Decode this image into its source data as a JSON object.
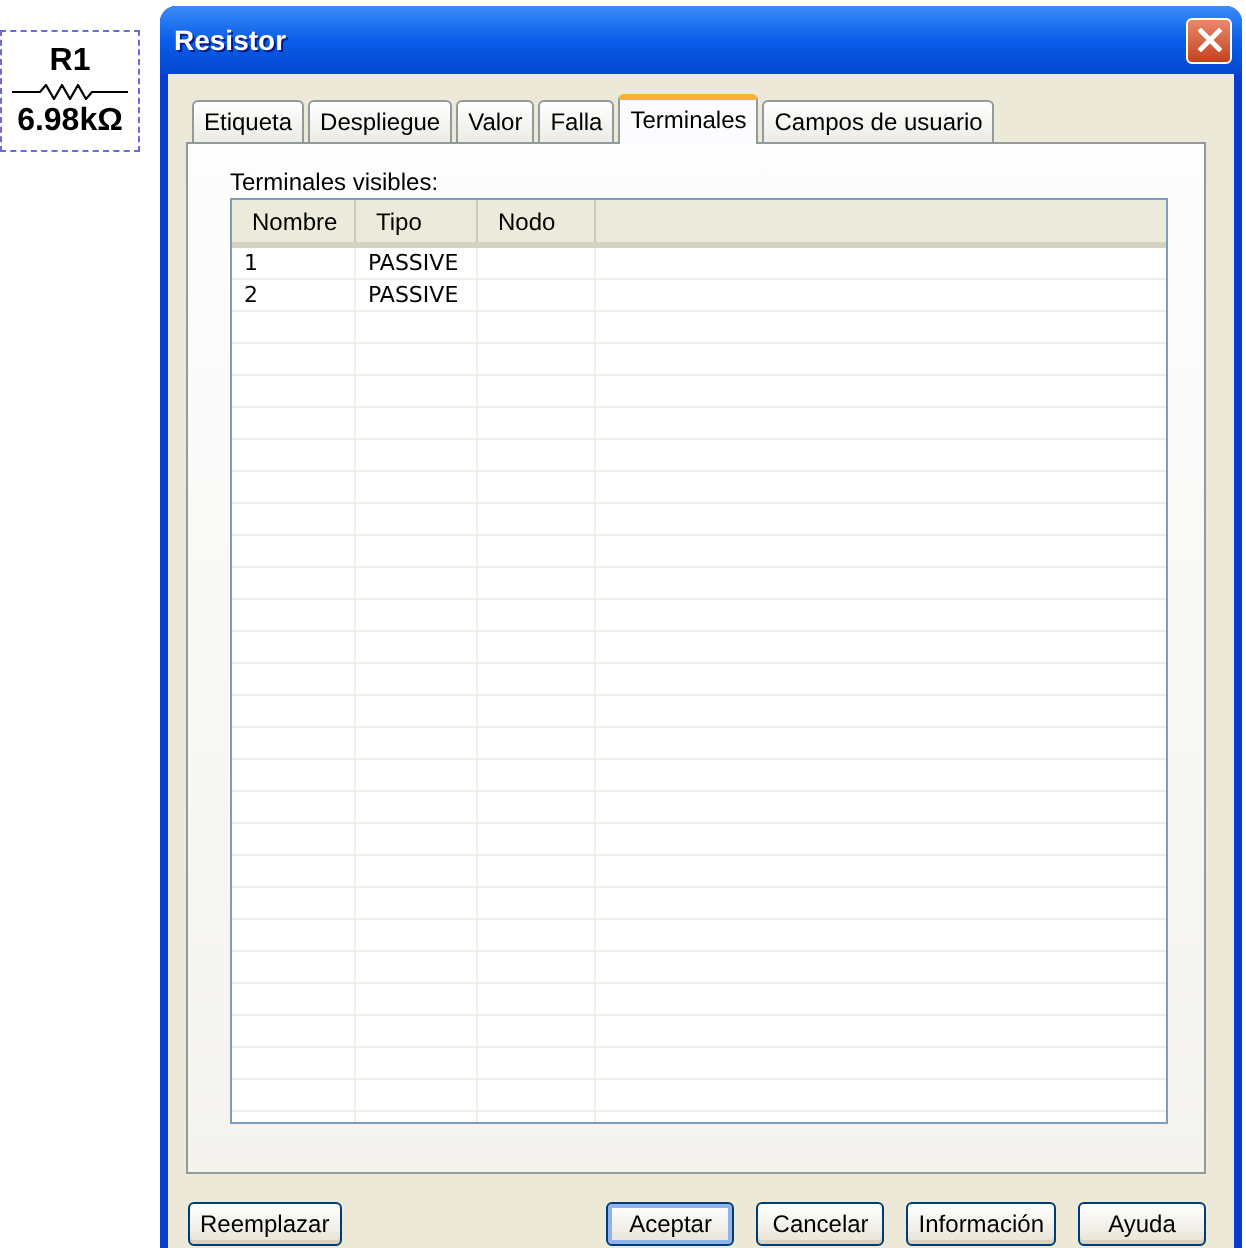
{
  "component": {
    "label": "R1",
    "value": "6.98kΩ"
  },
  "window": {
    "title": "Resistor"
  },
  "tabs": [
    {
      "label": "Etiqueta",
      "selected": false
    },
    {
      "label": "Despliegue",
      "selected": false
    },
    {
      "label": "Valor",
      "selected": false
    },
    {
      "label": "Falla",
      "selected": false
    },
    {
      "label": "Terminales",
      "selected": true
    },
    {
      "label": "Campos de usuario",
      "selected": false
    }
  ],
  "terminals": {
    "label": "Terminales visibles:",
    "columns": [
      "Nombre",
      "Tipo",
      "Nodo"
    ],
    "rows": [
      [
        "1",
        "PASSIVE"
      ],
      [
        "2",
        "PASSIVE"
      ]
    ]
  },
  "footer": {
    "left": [
      {
        "label": "Reemplazar",
        "default": false
      }
    ],
    "right": [
      {
        "label": "Aceptar",
        "default": true
      },
      {
        "label": "Cancelar",
        "default": false
      },
      {
        "label": "Información",
        "default": false
      },
      {
        "label": "Ayuda",
        "default": false
      }
    ]
  }
}
